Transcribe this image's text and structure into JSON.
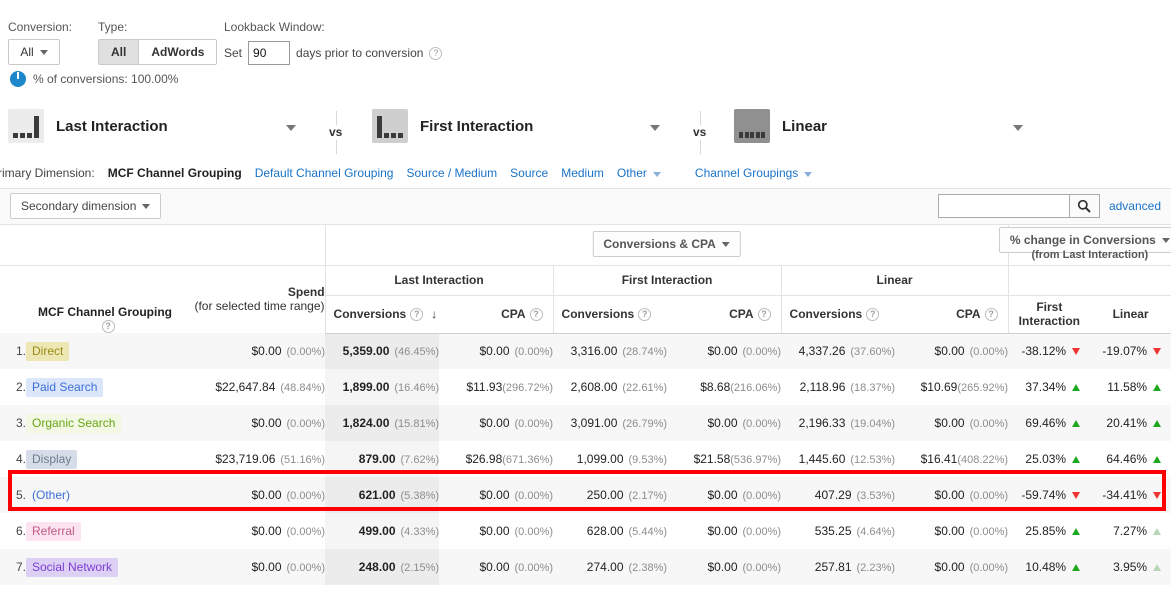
{
  "filters": {
    "conversion_label": "Conversion:",
    "conversion_value": "All",
    "type_label": "Type:",
    "type_options": [
      "All",
      "AdWords"
    ],
    "type_selected": "All",
    "lookback_label": "Lookback Window:",
    "lookback_set": "Set",
    "lookback_days": "90",
    "lookback_suffix": "days prior to conversion",
    "help_glyph": "?",
    "pct_conversions": "% of conversions: 100.00%"
  },
  "models": [
    {
      "name": "Last Interaction",
      "icon": "last-interaction-icon"
    },
    {
      "name": "First Interaction",
      "icon": "first-interaction-icon"
    },
    {
      "name": "Linear",
      "icon": "linear-icon"
    }
  ],
  "vs_label": "vs",
  "primary_dimension": {
    "label": "Primary Dimension:",
    "active": "MCF Channel Grouping",
    "links": [
      "Default Channel Grouping",
      "Source / Medium",
      "Source",
      "Medium"
    ],
    "other": "Other",
    "channel_groupings": "Channel Groupings"
  },
  "secondary": {
    "button": "Secondary dimension",
    "search_value": "",
    "search_placeholder": "",
    "search_icon": "search-icon",
    "advanced": "advanced"
  },
  "table": {
    "dimension_header": "MCF Channel Grouping",
    "spend_header": "Spend",
    "spend_sub": "(for selected time range)",
    "metric_group_selector": "Conversions & CPA",
    "change_selector": "% change in Conversions",
    "change_sub": "(from Last Interaction)",
    "groups": [
      "Last Interaction",
      "First Interaction",
      "Linear"
    ],
    "metric_conversions": "Conversions",
    "metric_cpa": "CPA",
    "change_cols": [
      "First\nInteraction",
      "Linear"
    ],
    "change_col_1_line1": "First",
    "change_col_1_line2": "Interaction",
    "change_col_2": "Linear",
    "sort_arrow": "↓",
    "rows": [
      {
        "index": "1.",
        "channel": "Direct",
        "badge_bg": "#ede7b3",
        "badge_fg": "#9a8b1a",
        "spend": "$0.00",
        "spend_pct": "(0.00%)",
        "li_conv": "5,359.00",
        "li_conv_pct": "(46.45%)",
        "li_cpa": "$0.00",
        "li_cpa_pct": "(0.00%)",
        "fi_conv": "3,316.00",
        "fi_conv_pct": "(28.74%)",
        "fi_cpa": "$0.00",
        "fi_cpa_pct": "(0.00%)",
        "ln_conv": "4,337.26",
        "ln_conv_pct": "(37.60%)",
        "ln_cpa": "$0.00",
        "ln_cpa_pct": "(0.00%)",
        "chg_fi": "-38.12%",
        "chg_fi_dir": "down",
        "chg_ln": "-19.07%",
        "chg_ln_dir": "down",
        "highlight": false
      },
      {
        "index": "2.",
        "channel": "Paid Search",
        "badge_bg": "#dce6fb",
        "badge_fg": "#3b6fd8",
        "spend": "$22,647.84",
        "spend_pct": "(48.84%)",
        "li_conv": "1,899.00",
        "li_conv_pct": "(16.46%)",
        "li_cpa": "$11.93",
        "li_cpa_pct": "(296.72%)",
        "fi_conv": "2,608.00",
        "fi_conv_pct": "(22.61%)",
        "fi_cpa": "$8.68",
        "fi_cpa_pct": "(216.06%)",
        "ln_conv": "2,118.96",
        "ln_conv_pct": "(18.37%)",
        "ln_cpa": "$10.69",
        "ln_cpa_pct": "(265.92%)",
        "chg_fi": "37.34%",
        "chg_fi_dir": "up",
        "chg_ln": "11.58%",
        "chg_ln_dir": "up",
        "highlight": false
      },
      {
        "index": "3.",
        "channel": "Organic Search",
        "badge_bg": "#f2f8e4",
        "badge_fg": "#6aa516",
        "spend": "$0.00",
        "spend_pct": "(0.00%)",
        "li_conv": "1,824.00",
        "li_conv_pct": "(15.81%)",
        "li_cpa": "$0.00",
        "li_cpa_pct": "(0.00%)",
        "fi_conv": "3,091.00",
        "fi_conv_pct": "(26.79%)",
        "fi_cpa": "$0.00",
        "fi_cpa_pct": "(0.00%)",
        "ln_conv": "2,196.33",
        "ln_conv_pct": "(19.04%)",
        "ln_cpa": "$0.00",
        "ln_cpa_pct": "(0.00%)",
        "chg_fi": "69.46%",
        "chg_fi_dir": "up",
        "chg_ln": "20.41%",
        "chg_ln_dir": "up",
        "highlight": false
      },
      {
        "index": "4.",
        "channel": "Display",
        "badge_bg": "#d6dde8",
        "badge_fg": "#6b7b8c",
        "spend": "$23,719.06",
        "spend_pct": "(51.16%)",
        "li_conv": "879.00",
        "li_conv_pct": "(7.62%)",
        "li_cpa": "$26.98",
        "li_cpa_pct": "(671.36%)",
        "fi_conv": "1,099.00",
        "fi_conv_pct": "(9.53%)",
        "fi_cpa": "$21.58",
        "fi_cpa_pct": "(536.97%)",
        "ln_conv": "1,445.60",
        "ln_conv_pct": "(12.53%)",
        "ln_cpa": "$16.41",
        "ln_cpa_pct": "(408.22%)",
        "chg_fi": "25.03%",
        "chg_fi_dir": "up",
        "chg_ln": "64.46%",
        "chg_ln_dir": "up",
        "highlight": true
      },
      {
        "index": "5.",
        "channel": "(Other)",
        "badge_bg": "transparent",
        "badge_fg": "#3b6fd8",
        "spend": "$0.00",
        "spend_pct": "(0.00%)",
        "li_conv": "621.00",
        "li_conv_pct": "(5.38%)",
        "li_cpa": "$0.00",
        "li_cpa_pct": "(0.00%)",
        "fi_conv": "250.00",
        "fi_conv_pct": "(2.17%)",
        "fi_cpa": "$0.00",
        "fi_cpa_pct": "(0.00%)",
        "ln_conv": "407.29",
        "ln_conv_pct": "(3.53%)",
        "ln_cpa": "$0.00",
        "ln_cpa_pct": "(0.00%)",
        "chg_fi": "-59.74%",
        "chg_fi_dir": "down",
        "chg_ln": "-34.41%",
        "chg_ln_dir": "down",
        "highlight": false
      },
      {
        "index": "6.",
        "channel": "Referral",
        "badge_bg": "#fbe4ef",
        "badge_fg": "#c05a8a",
        "spend": "$0.00",
        "spend_pct": "(0.00%)",
        "li_conv": "499.00",
        "li_conv_pct": "(4.33%)",
        "li_cpa": "$0.00",
        "li_cpa_pct": "(0.00%)",
        "fi_conv": "628.00",
        "fi_conv_pct": "(5.44%)",
        "fi_cpa": "$0.00",
        "fi_cpa_pct": "(0.00%)",
        "ln_conv": "535.25",
        "ln_conv_pct": "(4.64%)",
        "ln_cpa": "$0.00",
        "ln_cpa_pct": "(0.00%)",
        "chg_fi": "25.85%",
        "chg_fi_dir": "up",
        "chg_ln": "7.27%",
        "chg_ln_dir": "up-faint",
        "highlight": false
      },
      {
        "index": "7.",
        "channel": "Social Network",
        "badge_bg": "#ddd0f5",
        "badge_fg": "#7b3fd1",
        "spend": "$0.00",
        "spend_pct": "(0.00%)",
        "li_conv": "248.00",
        "li_conv_pct": "(2.15%)",
        "li_cpa": "$0.00",
        "li_cpa_pct": "(0.00%)",
        "fi_conv": "274.00",
        "fi_conv_pct": "(2.38%)",
        "fi_cpa": "$0.00",
        "fi_cpa_pct": "(0.00%)",
        "ln_conv": "257.81",
        "ln_conv_pct": "(2.23%)",
        "ln_cpa": "$0.00",
        "ln_cpa_pct": "(0.00%)",
        "chg_fi": "10.48%",
        "chg_fi_dir": "up",
        "chg_ln": "3.95%",
        "chg_ln_dir": "up-faint",
        "highlight": false
      }
    ]
  },
  "colors": {
    "link": "#1a73c8",
    "up": "#1fa81f",
    "down": "#ee3333",
    "highlight_box": "#ff0000"
  }
}
